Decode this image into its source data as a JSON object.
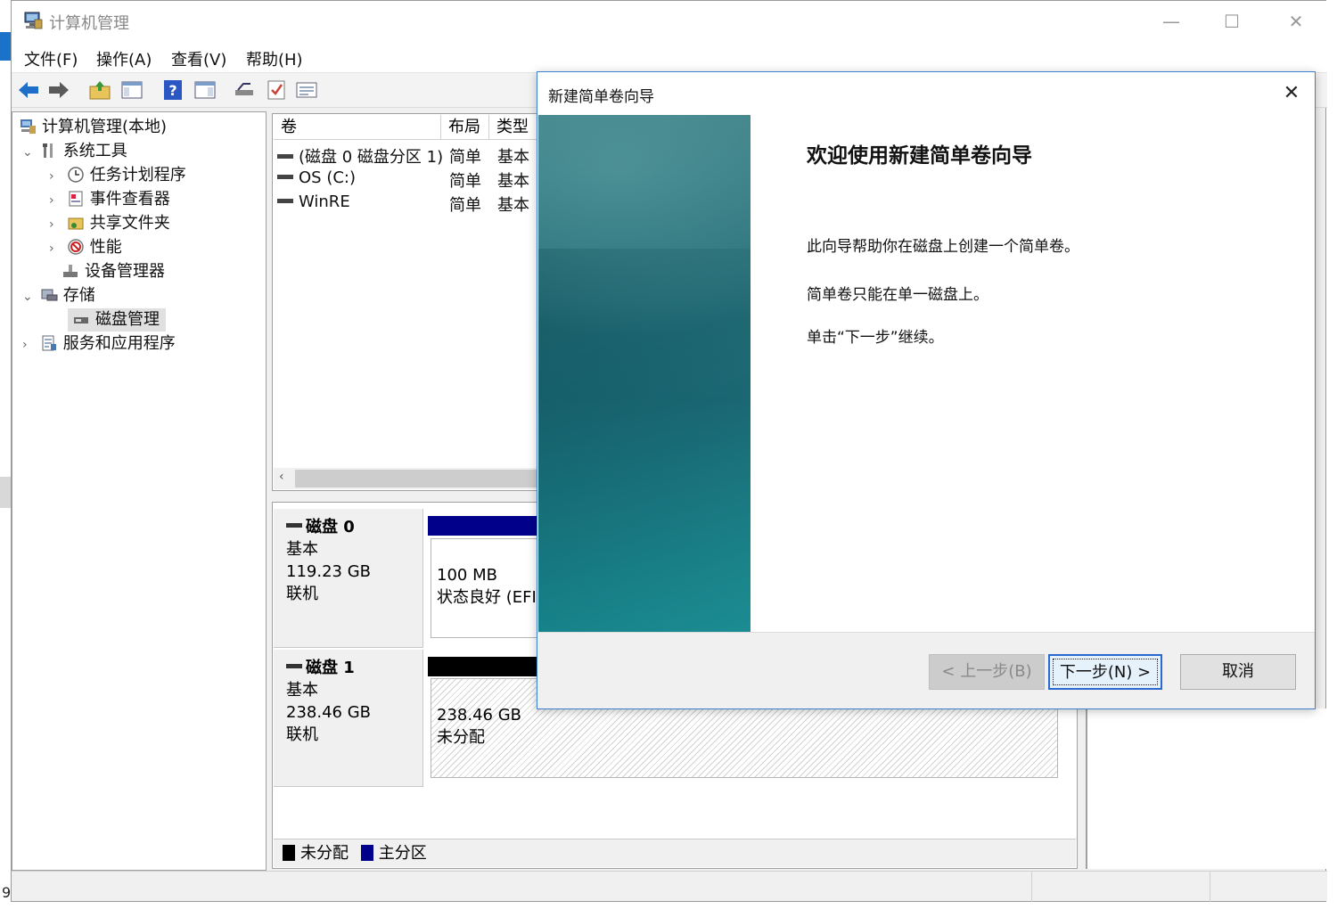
{
  "window": {
    "title": "计算机管理",
    "minimize": "—",
    "maximize": "☐",
    "close": "✕"
  },
  "menu": [
    "文件(F)",
    "操作(A)",
    "查看(V)",
    "帮助(H)"
  ],
  "toolbar": [
    "back-arrow-icon",
    "forward-arrow-icon",
    "folder-up-icon",
    "show-hide-console-icon",
    "help-icon",
    "show-hide-action-pane-icon",
    "connect-icon",
    "check-icon",
    "properties-icon"
  ],
  "tree": {
    "root": "计算机管理(本地)",
    "system_tools": "系统工具",
    "task_scheduler": "任务计划程序",
    "event_viewer": "事件查看器",
    "shared_folders": "共享文件夹",
    "performance": "性能",
    "device_manager": "设备管理器",
    "storage": "存储",
    "disk_management": "磁盘管理",
    "services_apps": "服务和应用程序"
  },
  "volumes": {
    "headers": [
      "卷",
      "布局",
      "类型"
    ],
    "rows": [
      {
        "name": "(磁盘 0 磁盘分区 1)",
        "layout": "简单",
        "type": "基本"
      },
      {
        "name": "OS (C:)",
        "layout": "简单",
        "type": "基本"
      },
      {
        "name": "WinRE",
        "layout": "简单",
        "type": "基本"
      }
    ]
  },
  "disks": [
    {
      "name": "磁盘 0",
      "type": "基本",
      "size": "119.23 GB",
      "status": "联机",
      "partition": {
        "size": "100 MB",
        "status": "状态良好 (EFI"
      }
    },
    {
      "name": "磁盘 1",
      "type": "基本",
      "size": "238.46 GB",
      "status": "联机",
      "partition": {
        "size": "238.46 GB",
        "status": "未分配"
      }
    }
  ],
  "legend": {
    "unallocated": "未分配",
    "primary": "主分区",
    "unallocated_color": "#000000",
    "primary_color": "#00008b"
  },
  "status_left": "9",
  "wizard": {
    "title": "新建简单卷向导",
    "heading": "欢迎使用新建简单卷向导",
    "line1": "此向导帮助你在磁盘上创建一个简单卷。",
    "line2": "简单卷只能在单一磁盘上。",
    "line3": "单击“下一步”继续。",
    "back_button": "< 上一步(B)",
    "next_button": "下一步(N) >",
    "cancel_button": "取消",
    "close": "✕"
  }
}
